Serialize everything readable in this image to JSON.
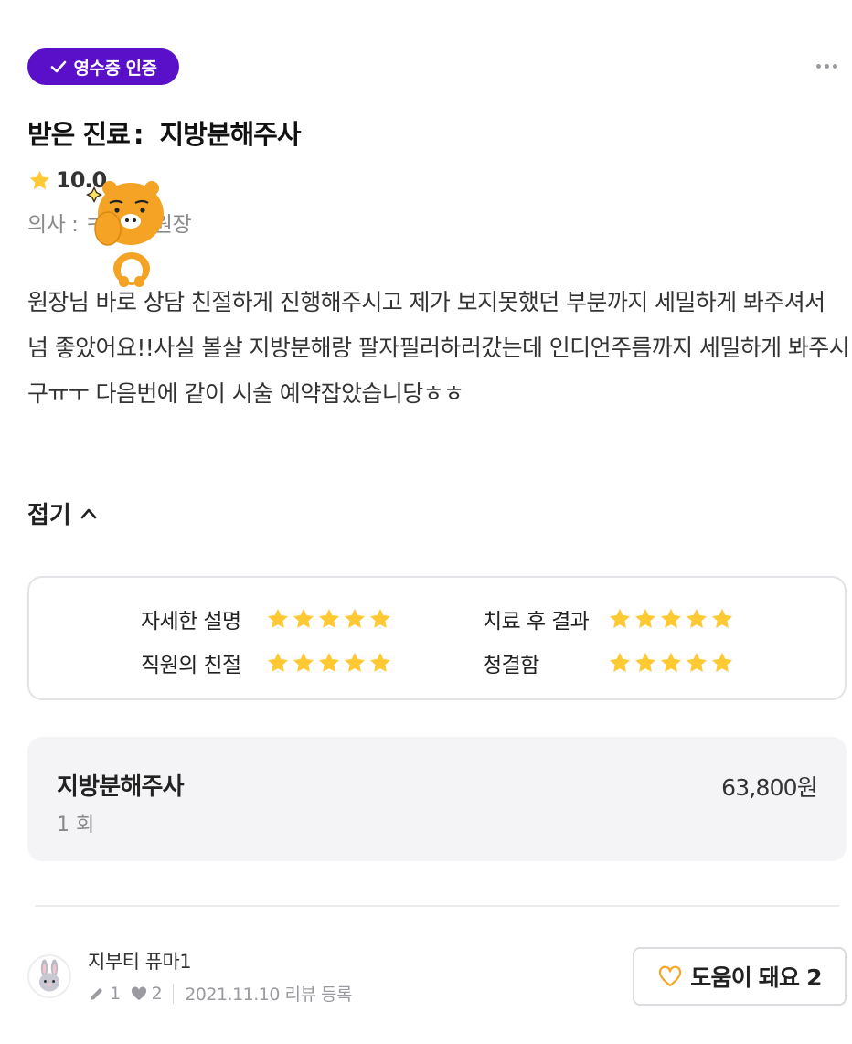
{
  "badge": {
    "label": "영수증 인증"
  },
  "treatment": {
    "prefix": "받은 진료",
    "separator": ":",
    "name": "지방분해주사"
  },
  "rating": {
    "score": "10.0"
  },
  "doctor": {
    "text": "의사 : ㅋ 의원 원장"
  },
  "review": {
    "text": "원장님 바로 상담 친절하게 진행해주시고 제가 보지못했던 부분까지 세밀하게 봐주셔서 넘 좋았어요!!사실 볼살 지방분해랑 팔자필러하러갔는데 인디언주름까지 세밀하게 봐주시구ㅠㅜ 다음번에 같이 시술 예약잡았습니당ㅎㅎ"
  },
  "fold": {
    "label": "접기"
  },
  "scores": [
    {
      "label": "자세한 설명",
      "stars": 5
    },
    {
      "label": "치료 후 결과",
      "stars": 5
    },
    {
      "label": "직원의 친절",
      "stars": 5
    },
    {
      "label": "청결함",
      "stars": 5
    }
  ],
  "price": {
    "name": "지방분해주사",
    "count": "1 회",
    "amount": "63,800원"
  },
  "user": {
    "name": "지부티 퓨마1",
    "reviews": "1",
    "likes": "2",
    "date": "2021.11.10 리뷰 등록"
  },
  "help_button": {
    "label": "도움이 돼요 2"
  },
  "colors": {
    "badge": "#5a0fc8",
    "star": "#ffc933",
    "heart": "#f5a623"
  }
}
